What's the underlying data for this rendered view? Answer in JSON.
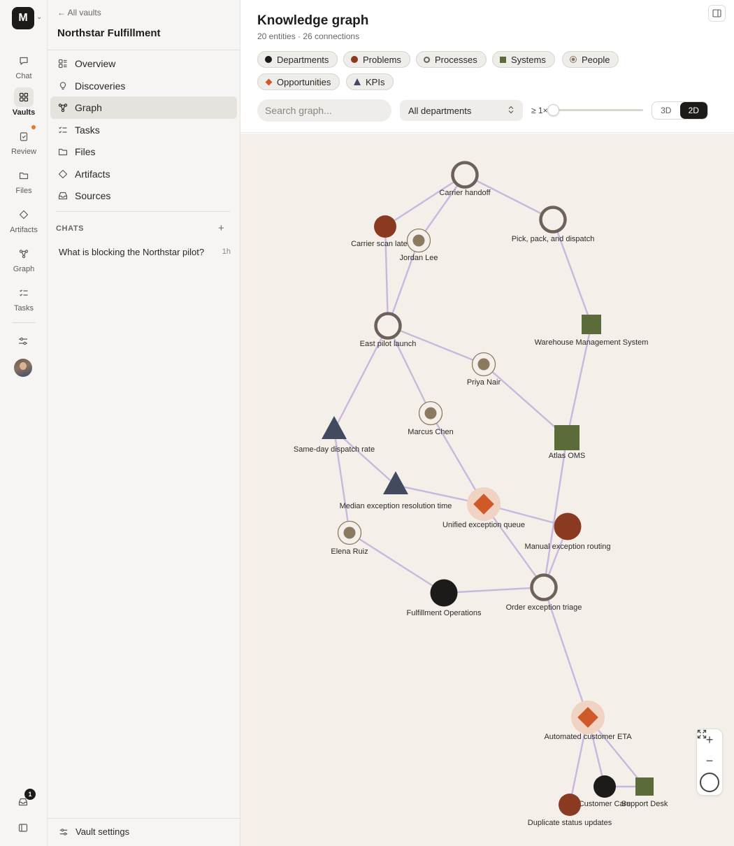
{
  "rail": {
    "workspace_letter": "M",
    "items": [
      {
        "label": "Chat"
      },
      {
        "label": "Vaults"
      },
      {
        "label": "Review"
      },
      {
        "label": "Files"
      },
      {
        "label": "Artifacts"
      },
      {
        "label": "Graph"
      },
      {
        "label": "Tasks"
      }
    ],
    "inbox_count": "1",
    "accent": "#e07b35"
  },
  "sidebar": {
    "back_label": "← All vaults",
    "vault_name": "Northstar Fulfillment",
    "nav": [
      {
        "label": "Overview",
        "icon": "overview-icon"
      },
      {
        "label": "Discoveries",
        "icon": "lightbulb-icon"
      },
      {
        "label": "Graph",
        "icon": "graph-icon",
        "active": true
      },
      {
        "label": "Tasks",
        "icon": "tasks-icon"
      },
      {
        "label": "Files",
        "icon": "folder-icon"
      },
      {
        "label": "Artifacts",
        "icon": "diamond-icon"
      },
      {
        "label": "Sources",
        "icon": "inbox-icon"
      }
    ],
    "chats_heading": "CHATS",
    "chats": [
      {
        "title": "What is blocking the Northstar pilot?",
        "time": "1h"
      }
    ],
    "settings_label": "Vault settings"
  },
  "graph": {
    "title": "Knowledge graph",
    "subtitle": "20 entities · 26 connections",
    "filters": [
      {
        "label": "Departments",
        "shape": "circle",
        "color": "#1c1b1a"
      },
      {
        "label": "Problems",
        "shape": "circle",
        "color": "#8b3a22"
      },
      {
        "label": "Processes",
        "shape": "ring",
        "color": "#6d625a"
      },
      {
        "label": "Systems",
        "shape": "square",
        "color": "#5b6b3a"
      },
      {
        "label": "People",
        "shape": "target",
        "color": "#8a7a60"
      },
      {
        "label": "Opportunities",
        "shape": "diamond",
        "color": "#d0592a"
      },
      {
        "label": "KPIs",
        "shape": "triangle",
        "color": "#414a5f"
      }
    ],
    "search_placeholder": "Search graph...",
    "department_select": "All departments",
    "weight_label": "≥ 1×",
    "weight_value": 1,
    "view_modes": [
      "3D",
      "2D"
    ],
    "active_view": "2D",
    "edge_color": "#c8b8e0"
  },
  "nodes": [
    {
      "id": "carrier-handoff",
      "label": "Carrier handoff",
      "type": "process"
    },
    {
      "id": "carrier-scan",
      "label": "Carrier scan latency",
      "type": "problem"
    },
    {
      "id": "jordan",
      "label": "Jordan Lee",
      "type": "person"
    },
    {
      "id": "pick-pack",
      "label": "Pick, pack, and dispatch",
      "type": "process"
    },
    {
      "id": "east-pilot",
      "label": "East pilot launch",
      "type": "process"
    },
    {
      "id": "wms",
      "label": "Warehouse Management System",
      "type": "system"
    },
    {
      "id": "priya",
      "label": "Priya Nair",
      "type": "person"
    },
    {
      "id": "marcus",
      "label": "Marcus Chen",
      "type": "person"
    },
    {
      "id": "same-day",
      "label": "Same-day dispatch rate",
      "type": "kpi"
    },
    {
      "id": "atlas",
      "label": "Atlas OMS",
      "type": "system"
    },
    {
      "id": "median",
      "label": "Median exception resolution time",
      "type": "kpi"
    },
    {
      "id": "unified",
      "label": "Unified exception queue",
      "type": "opportunity"
    },
    {
      "id": "manual",
      "label": "Manual exception routing",
      "type": "problem"
    },
    {
      "id": "elena",
      "label": "Elena Ruiz",
      "type": "person"
    },
    {
      "id": "fulfillment",
      "label": "Fulfillment Operations",
      "type": "department"
    },
    {
      "id": "triage",
      "label": "Order exception triage",
      "type": "process"
    },
    {
      "id": "auto-eta",
      "label": "Automated customer ETA",
      "type": "opportunity"
    },
    {
      "id": "customer-care",
      "label": "Customer Care",
      "type": "department"
    },
    {
      "id": "support-desk",
      "label": "Support Desk",
      "type": "system"
    },
    {
      "id": "dup-status",
      "label": "Duplicate status updates",
      "type": "problem"
    }
  ],
  "edges": [
    [
      "carrier-handoff",
      "carrier-scan"
    ],
    [
      "carrier-handoff",
      "jordan"
    ],
    [
      "carrier-handoff",
      "pick-pack"
    ],
    [
      "carrier-scan",
      "east-pilot"
    ],
    [
      "jordan",
      "east-pilot"
    ],
    [
      "pick-pack",
      "wms"
    ],
    [
      "east-pilot",
      "priya"
    ],
    [
      "east-pilot",
      "marcus"
    ],
    [
      "east-pilot",
      "same-day"
    ],
    [
      "wms",
      "atlas"
    ],
    [
      "priya",
      "atlas"
    ],
    [
      "marcus",
      "unified"
    ],
    [
      "same-day",
      "median"
    ],
    [
      "same-day",
      "elena"
    ],
    [
      "median",
      "unified"
    ],
    [
      "atlas",
      "triage"
    ],
    [
      "unified",
      "manual"
    ],
    [
      "unified",
      "triage"
    ],
    [
      "manual",
      "triage"
    ],
    [
      "elena",
      "fulfillment"
    ],
    [
      "fulfillment",
      "triage"
    ],
    [
      "triage",
      "auto-eta"
    ],
    [
      "auto-eta",
      "customer-care"
    ],
    [
      "auto-eta",
      "support-desk"
    ],
    [
      "auto-eta",
      "dup-status"
    ],
    [
      "customer-care",
      "support-desk"
    ]
  ]
}
